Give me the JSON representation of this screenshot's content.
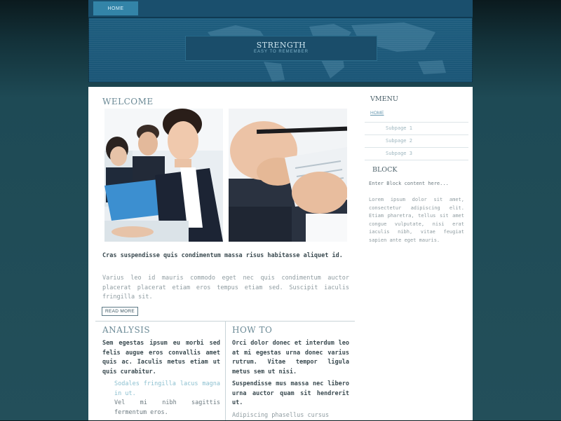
{
  "nav": {
    "home_label": "HOME"
  },
  "header": {
    "title": "STRENGTH",
    "slogan": "EASY TO REMEMBER"
  },
  "welcome": {
    "title": "WELCOME",
    "lead": "Cras suspendisse quis condimentum massa risus habitasse aliquet id.",
    "paragraph": "Varius leo id mauris commodo eget nec quis condimentum auctor placerat placerat etiam eros tempus etiam sed. Suscipit iaculis fringilla sit.",
    "read_more": "READ MORE"
  },
  "analysis": {
    "title": "ANALYSIS",
    "lead": "Sem egestas ipsum eu morbi sed felis augue eros convallis amet quis ac. Iaculis metus etiam ut quis curabitur.",
    "link_text": "Sodales fringilla lacus magna in ut.",
    "text": "Vel mi nibh sagittis fermentum eros."
  },
  "howto": {
    "title": "HOW TO",
    "lead": "Orci dolor donec et interdum leo at mi egestas urna donec varius rutrum. Vitae tempor ligula metus sem ut nisi.",
    "lead2": "Suspendisse mus massa nec libero urna auctor quam sit hendrerit ut.",
    "text": "Adipiscing phasellus cursus"
  },
  "sidebar": {
    "vmenu_title": "VMENU",
    "home": "HOME",
    "subpages": [
      "Subpage 1",
      "Subpage 2",
      "Subpage 3"
    ],
    "block_title": "BLOCK",
    "block_enter": "Enter Block content here...",
    "block_text": "Lorem ipsum dolor sit amet, consectetur adipiscing elit. Etiam pharetra, tellus sit amet congue vulputate, nisi erat iaculis nibh, vitae feugiat sapien ante eget mauris."
  },
  "colors": {
    "header_blue": "#1e5f80",
    "accent": "#3384a8",
    "background": "#234f5a"
  }
}
